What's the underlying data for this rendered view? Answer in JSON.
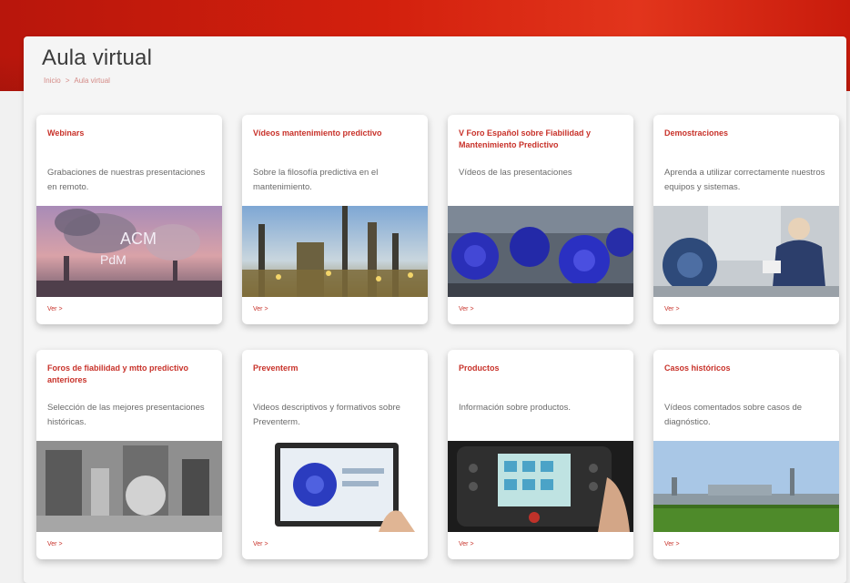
{
  "page": {
    "title": "Aula virtual",
    "breadcrumb": [
      "Inicio",
      ">",
      "Aula virtual"
    ]
  },
  "colors": {
    "brand": "#c8322a",
    "banner": "#d3200d"
  },
  "cards": [
    {
      "title": "Webinars",
      "description": "Grabaciones de nuestras presentaciones en remoto.",
      "link": "Ver >",
      "image_text": [
        "ACM",
        "PdM"
      ]
    },
    {
      "title": "Vídeos mantenimiento predictivo",
      "description": "Sobre la filosofía predictiva en el mantenimiento.",
      "link": "Ver >"
    },
    {
      "title": "V Foro Español sobre Fiabilidad y Mantenimiento Predictivo",
      "description": "Vídeos de las presentaciones",
      "link": "Ver >"
    },
    {
      "title": "Demostraciones",
      "description": "Aprenda a utilizar correctamente nuestros equipos y sistemas.",
      "link": "Ver >"
    },
    {
      "title": "Foros de fiabilidad y mtto predictivo anteriores",
      "description": "Selección de las mejores presentaciones históricas.",
      "link": "Ver >"
    },
    {
      "title": "Preventerm",
      "description": "Videos descriptivos y formativos sobre Preventerm.",
      "link": "Ver >"
    },
    {
      "title": "Productos",
      "description": "Información sobre productos.",
      "link": "Ver >"
    },
    {
      "title": "Casos históricos",
      "description": "Vídeos comentados sobre casos de diagnóstico.",
      "link": "Ver >"
    }
  ]
}
